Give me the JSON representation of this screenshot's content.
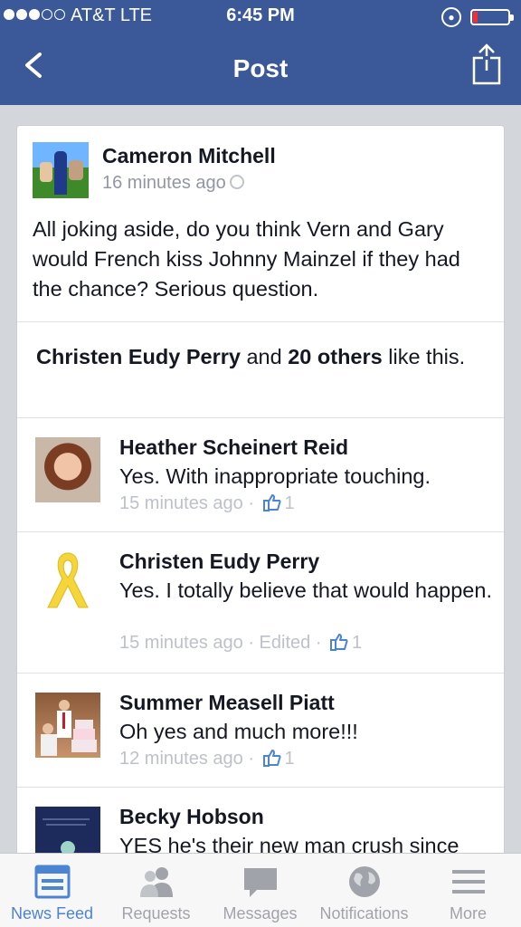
{
  "status_bar": {
    "carrier": "AT&T  LTE",
    "time": "6:45 PM",
    "battery_color": "#ff2a2a"
  },
  "nav": {
    "title": "Post",
    "back_icon": "chevron-left-icon",
    "share_icon": "share-icon"
  },
  "post": {
    "author": "Cameron Mitchell",
    "time": "16 minutes ago",
    "text": "All joking aside, do you think Vern and Gary would French kiss Johnny Mainzel if they had the chance? Serious question."
  },
  "likes": {
    "name": "Christen Eudy Perry",
    "and": " and ",
    "others": "20 others",
    "suffix": " like this."
  },
  "comments": [
    {
      "name": "Heather Scheinert Reid",
      "text": "Yes.  With inappropriate touching.",
      "time": "15 minutes ago",
      "sep": " · ",
      "likes": "1"
    },
    {
      "name": "Christen Eudy Perry",
      "text": "Yes. I totally believe that would happen.",
      "time": "15 minutes ago",
      "sep": " · ",
      "edited": "Edited",
      "likes": "1"
    },
    {
      "name": "Summer Measell Piatt",
      "text": "Oh yes and much more!!!",
      "time": "12 minutes ago",
      "sep": " · ",
      "likes": "1"
    },
    {
      "name": "Becky Hobson",
      "text": "YES he's their new man crush since"
    }
  ],
  "tabs": [
    {
      "label": "News Feed",
      "icon": "news-feed-icon"
    },
    {
      "label": "Requests",
      "icon": "friend-requests-icon"
    },
    {
      "label": "Messages",
      "icon": "messages-icon"
    },
    {
      "label": "Notifications",
      "icon": "globe-icon"
    },
    {
      "label": "More",
      "icon": "menu-icon"
    }
  ],
  "colors": {
    "brand": "#3b5998",
    "active_tab": "#4c84d4"
  }
}
